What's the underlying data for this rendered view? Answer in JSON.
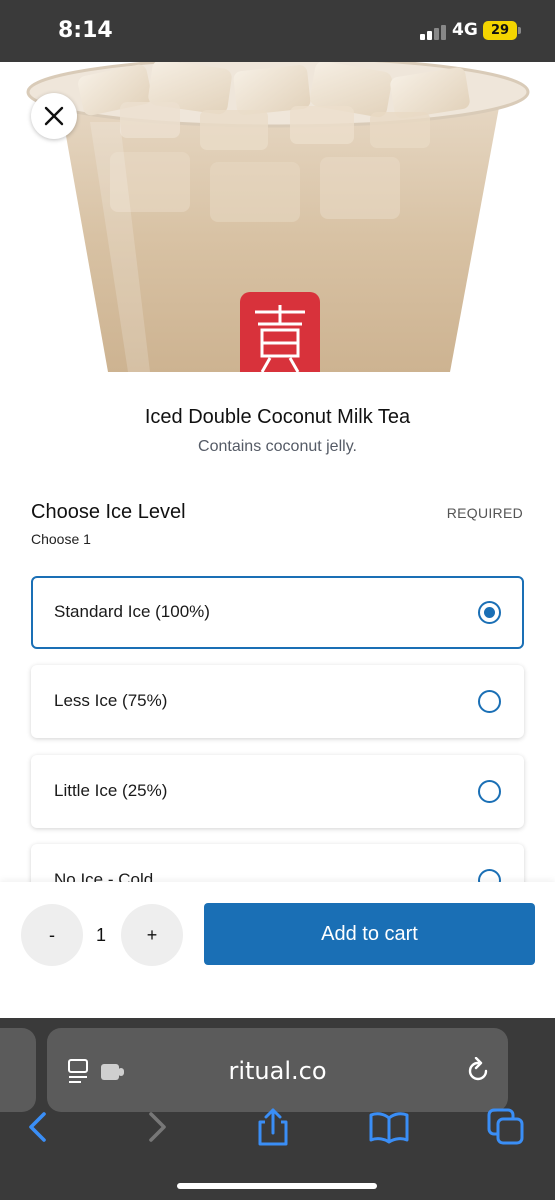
{
  "status_bar": {
    "time": "8:14",
    "network": "4G",
    "battery": "29"
  },
  "product": {
    "name": "Iced Double Coconut Milk Tea",
    "description": "Contains coconut jelly."
  },
  "ice_section": {
    "title": "Choose Ice Level",
    "required_label": "REQUIRED",
    "subtitle": "Choose 1",
    "options": [
      {
        "label": "Standard Ice (100%)",
        "selected": true
      },
      {
        "label": "Less Ice (75%)",
        "selected": false
      },
      {
        "label": "Little Ice (25%)",
        "selected": false
      },
      {
        "label": "No Ice - Cold",
        "selected": false
      }
    ]
  },
  "cart": {
    "decrement_label": "-",
    "quantity": "1",
    "increment_label": "+",
    "add_to_cart_label": "Add to cart"
  },
  "browser": {
    "url": "ritual.co"
  },
  "icons": {
    "close": "close-icon",
    "reader": "reader-icon",
    "extension": "extension-icon",
    "reload": "reload-icon",
    "back": "chevron-left-icon",
    "forward": "chevron-right-icon",
    "share": "share-icon",
    "bookmarks": "book-icon",
    "tabs": "tabs-icon"
  },
  "colors": {
    "accent": "#1a6fb5",
    "brand_logo": "#d8323b",
    "chrome": "#3a3a3a",
    "battery": "#f3d400"
  }
}
